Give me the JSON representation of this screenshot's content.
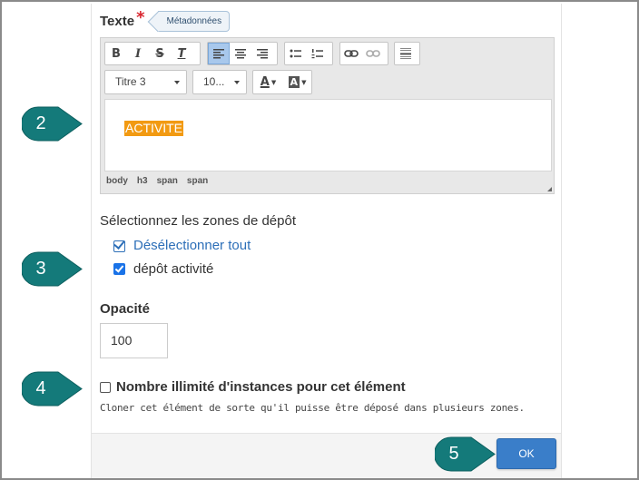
{
  "texte": {
    "label": "Texte",
    "required_mark": "*",
    "meta_button": "Métadonnées"
  },
  "toolbar": {
    "format_combo": "Titre 3",
    "size_combo": "10...",
    "text_color_glyph": "A",
    "bg_color_glyph": "A",
    "bold_glyph": "B",
    "italic_glyph": "I",
    "strike_glyph": "S",
    "clear_glyph": "T"
  },
  "editor": {
    "content": "ACTIVITE",
    "path": [
      "body",
      "h3",
      "span",
      "span"
    ],
    "highlight_color": "#f29a12"
  },
  "zones": {
    "title": "Sélectionnez les zones de dépôt",
    "deselect_all": "Désélectionner tout",
    "items": [
      {
        "label": "dépôt activité",
        "checked": true
      }
    ]
  },
  "opacity": {
    "label": "Opacité",
    "value": "100"
  },
  "unlimited": {
    "label": "Nombre illimité d'instances pour cet élément",
    "description": "Cloner cet élément de sorte qu'il puisse être déposé dans plusieurs zones.",
    "checked": false
  },
  "footer": {
    "ok_label": "OK"
  },
  "callouts": [
    "2",
    "3",
    "4",
    "5"
  ],
  "colors": {
    "callout": "#147a7a",
    "accent": "#3a7ec9"
  }
}
